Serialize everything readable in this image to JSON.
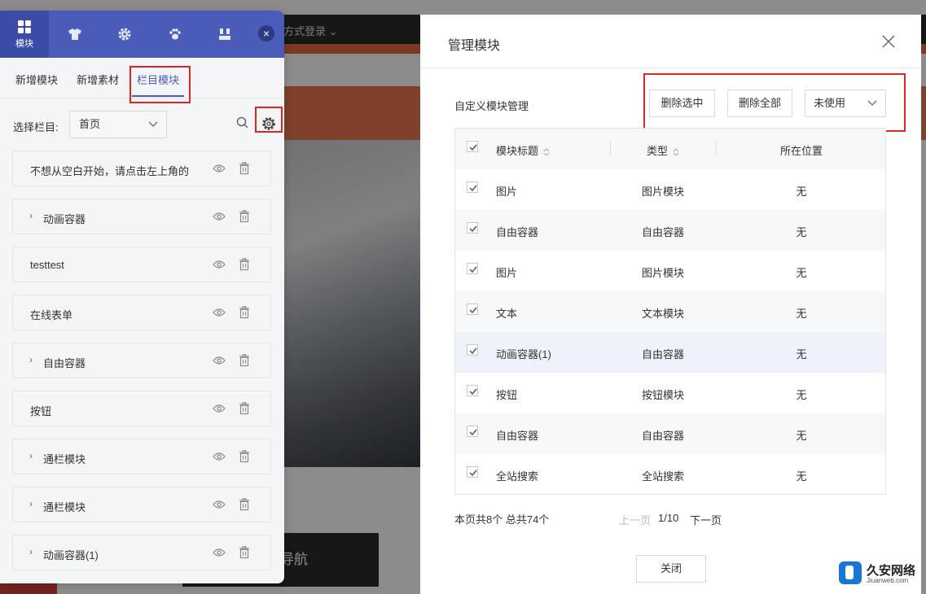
{
  "background": {
    "login_text": "方式登录 ⌄",
    "nav_button": "导航"
  },
  "left_panel": {
    "tabs": [
      {
        "icon": "modules-grid-icon",
        "label": "模块",
        "active": true
      },
      {
        "icon": "shirt-icon",
        "label": ""
      },
      {
        "icon": "gear-icon",
        "label": ""
      },
      {
        "icon": "paw-icon",
        "label": ""
      },
      {
        "icon": "layout-icon",
        "label": ""
      }
    ],
    "close_label": "×",
    "subtabs": [
      "新增模块",
      "新增素材",
      "栏目模块"
    ],
    "active_subtab": "栏目模块",
    "select_label": "选择栏目:",
    "select_value": "首页",
    "items": [
      {
        "label": "不想从空白开始，请点击左上角的",
        "expandable": false
      },
      {
        "label": "动画容器",
        "expandable": true
      },
      {
        "label": "testtest",
        "expandable": false
      },
      {
        "label": "在线表单",
        "expandable": false
      },
      {
        "label": "自由容器",
        "expandable": true
      },
      {
        "label": "按钮",
        "expandable": false
      },
      {
        "label": "通栏模块",
        "expandable": true
      },
      {
        "label": "通栏模块",
        "expandable": true
      },
      {
        "label": "动画容器(1)",
        "expandable": true
      }
    ]
  },
  "modal": {
    "title": "管理模块",
    "section_label": "自定义模块管理",
    "delete_selected": "删除选中",
    "delete_all": "删除全部",
    "filter_value": "未使用",
    "columns": [
      "模块标题",
      "类型",
      "所在位置"
    ],
    "rows": [
      {
        "title": "图片",
        "type": "图片模块",
        "location": "无",
        "checked": true
      },
      {
        "title": "自由容器",
        "type": "自由容器",
        "location": "无",
        "checked": true
      },
      {
        "title": "图片",
        "type": "图片模块",
        "location": "无",
        "checked": true
      },
      {
        "title": "文本",
        "type": "文本模块",
        "location": "无",
        "checked": true
      },
      {
        "title": "动画容器(1)",
        "type": "自由容器",
        "location": "无",
        "checked": true
      },
      {
        "title": "按钮",
        "type": "按钮模块",
        "location": "无",
        "checked": true
      },
      {
        "title": "自由容器",
        "type": "自由容器",
        "location": "无",
        "checked": true
      },
      {
        "title": "全站搜索",
        "type": "全站搜索",
        "location": "无",
        "checked": true
      }
    ],
    "pager": {
      "info": "本页共8个  总共74个",
      "prev": "上一页",
      "page": "1/10",
      "next": "下一页"
    },
    "close_button": "关闭"
  },
  "watermark": {
    "text": "久安网络",
    "sub": "Jiuanweb.com"
  },
  "colors": {
    "accent": "#4b5cb8",
    "highlight_border": "#e02424",
    "orange": "#e77650"
  }
}
